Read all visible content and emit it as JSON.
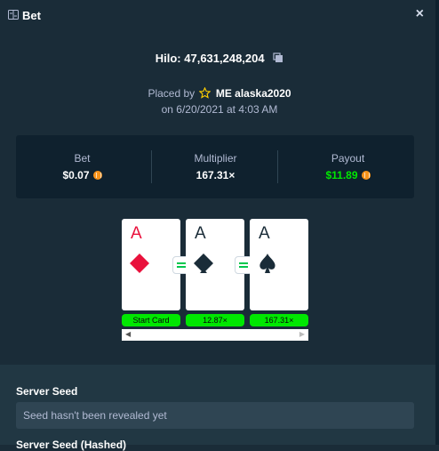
{
  "header": {
    "title": "Bet",
    "close": "×"
  },
  "game": {
    "label": "Hilo: 47,631,248,204"
  },
  "placed": {
    "prefix": "Placed by",
    "user": "ME alaska2020",
    "date": "on 6/20/2021 at 4:03 AM"
  },
  "stats": {
    "bet": {
      "label": "Bet",
      "value": "$0.07"
    },
    "multiplier": {
      "label": "Multiplier",
      "value": "167.31×"
    },
    "payout": {
      "label": "Payout",
      "value": "$11.89"
    }
  },
  "cards": [
    {
      "rank": "A",
      "suit": "diamond",
      "color": "#e9113c",
      "pill": "Start Card"
    },
    {
      "rank": "A",
      "suit": "club",
      "color": "#1a2c38",
      "pill": "12.87×"
    },
    {
      "rank": "A",
      "suit": "spade",
      "color": "#1a2c38",
      "pill": "167.31×"
    }
  ],
  "seeds": {
    "server_label": "Server Seed",
    "server_value": "Seed hasn't been revealed yet",
    "hashed_label": "Server Seed (Hashed)"
  },
  "colors": {
    "background": "#1a2c38",
    "panel": "#0f212e",
    "accent_green": "#00e701",
    "red_suit": "#e9113c"
  }
}
